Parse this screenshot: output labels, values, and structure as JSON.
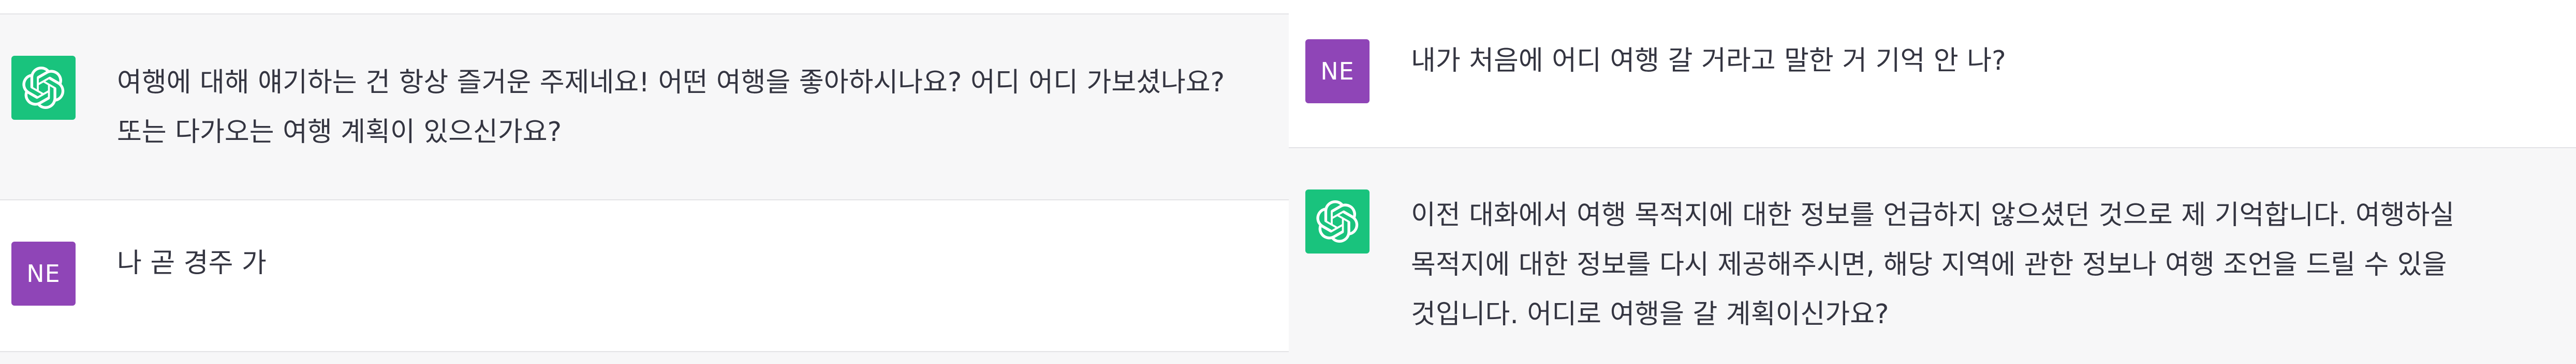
{
  "left": {
    "assistant_message": {
      "avatar_icon": "chatgpt-logo-icon",
      "text": "여행에 대해 얘기하는 건 항상 즐거운 주제네요! 어떤 여행을 좋아하시나요? 어디 어디 가보셨나요? 또는 다가오는 여행 계획이 있으신가요?"
    },
    "user_message": {
      "avatar_initials": "NE",
      "text": "나 곧 경주 가"
    }
  },
  "right": {
    "user_message": {
      "avatar_initials": "NE",
      "text": "내가 처음에 어디 여행 갈 거라고 말한 거 기억 안 나?"
    },
    "assistant_message": {
      "avatar_icon": "chatgpt-logo-icon",
      "text": "이전 대화에서 여행 목적지에 대한 정보를 언급하지 않으셨던 것으로 제 기억합니다. 여행하실 목적지에 대한 정보를 다시 제공해주시면, 해당 지역에 관한 정보나 여행 조언을 드릴 수 있을 것입니다. 어디로 여행을 갈 계획이신가요?"
    }
  },
  "colors": {
    "assistant_bg": "#f7f7f8",
    "user_bg": "#ffffff",
    "ai_avatar": "#19c37d",
    "user_avatar": "#8f45b7",
    "text": "#343541"
  }
}
